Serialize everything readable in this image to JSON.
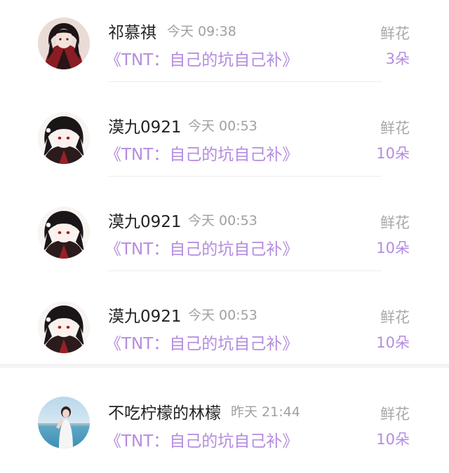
{
  "gifts": [
    {
      "name": "祁慕祺",
      "time": "今天 09:38",
      "book": "《TNT：自己的坑自己补》",
      "gift": "鲜花",
      "count": "3朵",
      "avatar_icon": "avatar-boy-red-robe"
    },
    {
      "name": "漠九0921",
      "time": "今天 00:53",
      "book": "《TNT：自己的坑自己补》",
      "gift": "鲜花",
      "count": "10朵",
      "avatar_icon": "avatar-anime-black-hair"
    },
    {
      "name": "漠九0921",
      "time": "今天 00:53",
      "book": "《TNT：自己的坑自己补》",
      "gift": "鲜花",
      "count": "10朵",
      "avatar_icon": "avatar-anime-black-hair"
    },
    {
      "name": "漠九0921",
      "time": "今天 00:53",
      "book": "《TNT：自己的坑自己补》",
      "gift": "鲜花",
      "count": "10朵",
      "avatar_icon": "avatar-anime-black-hair"
    },
    {
      "name": "不吃柠檬的林檬",
      "time": "昨天 21:44",
      "book": "《TNT：自己的坑自己补》",
      "gift": "鲜花",
      "count": "10朵",
      "avatar_icon": "avatar-girl-seaside"
    }
  ],
  "colors": {
    "accent_purple": "#b48ce0",
    "name_text": "#222222",
    "meta_text": "#a0a0a0"
  }
}
